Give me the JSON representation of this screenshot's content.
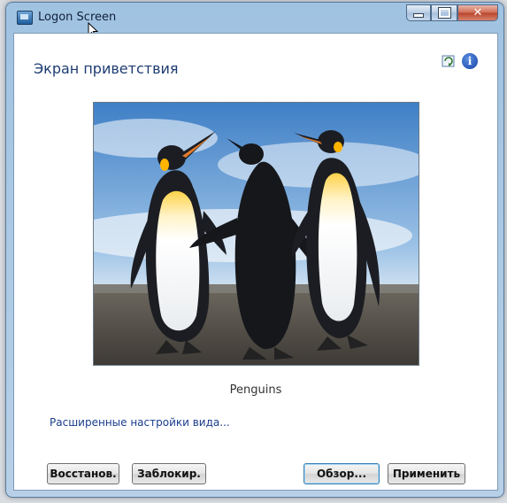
{
  "window": {
    "title": "Logon Screen"
  },
  "page": {
    "heading": "Экран приветствия",
    "preview_caption": "Penguins",
    "advanced_link": "Расширенные настройки вида..."
  },
  "icons": {
    "app": "monitor-icon",
    "refresh": "refresh-icon",
    "info": "info-icon",
    "info_glyph": "i",
    "close_glyph": "✕"
  },
  "buttons": {
    "restore": "Восстанов.",
    "lock": "Заблокир.",
    "browse": "Обзор...",
    "apply": "Применить"
  },
  "colors": {
    "heading": "#1d3c72",
    "link": "#1a3d8f",
    "frame": "#9fc3e4"
  }
}
